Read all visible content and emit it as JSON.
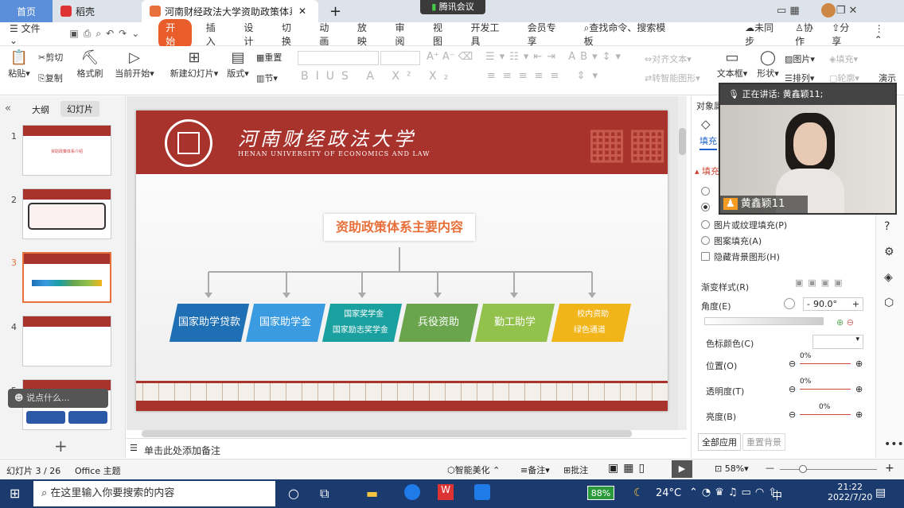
{
  "tabs": {
    "home": "首页",
    "daoke": "稻壳",
    "doc": "河南财经政法大学资助政策体系",
    "meeting": "腾讯会议"
  },
  "menu": {
    "file": "文件",
    "start": "开始",
    "items": [
      "插入",
      "设计",
      "切换",
      "动画",
      "放映",
      "审阅",
      "视图",
      "开发工具",
      "会员专享"
    ],
    "search": "查找命令、搜索模板",
    "sync": "未同步",
    "collab": "协作",
    "share": "分享"
  },
  "ribbon": {
    "paste": "粘贴",
    "cut": "剪切",
    "copy": "复制",
    "format_painter": "格式刷",
    "play_from_current": "当前开始",
    "new_slide": "新建幻灯片",
    "layout": "版式",
    "reset": "重置",
    "section": "节",
    "align_text": "对齐文本",
    "smart_graphic": "转智能图形",
    "textbox": "文本框",
    "shape": "形状",
    "picture": "图片",
    "fill": "填充",
    "arrange": "排列",
    "outline": "轮廓",
    "presenter": "演示"
  },
  "left_panel": {
    "outline_tab": "大纲",
    "slides_tab": "幻灯片",
    "thumb1_title": "资助政策体系介绍",
    "tooltip": "说点什么..."
  },
  "slide": {
    "univ_cn": "河南财经政法大学",
    "univ_en": "HENAN UNIVERSITY OF ECONOMICS AND LAW",
    "title": "资助政策体系主要内容",
    "boxes": [
      {
        "lines": [
          "国家助学贷款"
        ],
        "color": "#1e6fb3"
      },
      {
        "lines": [
          "国家助学金"
        ],
        "color": "#3a9be0"
      },
      {
        "lines": [
          "国家奖学金",
          "国家励志奖学金"
        ],
        "color": "#1ba0a0"
      },
      {
        "lines": [
          "兵役资助"
        ],
        "color": "#6aa54e"
      },
      {
        "lines": [
          "勤工助学"
        ],
        "color": "#92c14c"
      },
      {
        "lines": [
          "校内资助",
          "绿色通道"
        ],
        "color": "#f2b519"
      }
    ]
  },
  "notes_placeholder": "单击此处添加备注",
  "right_panel": {
    "object_props": "对象属",
    "fill_tab": "填充",
    "fill_section": "填充",
    "opt_picture_fill": "图片或纹理填充(P)",
    "opt_pattern_fill": "图案填充(A)",
    "opt_hide_bg": "隐藏背景图形(H)",
    "gradient_style": "渐变样式(R)",
    "angle_label": "角度(E)",
    "angle_value": "90.0°",
    "stop_color": "色标颜色(C)",
    "position": "位置(O)",
    "transparency": "透明度(T)",
    "brightness": "亮度(B)",
    "pct": "0%",
    "apply_all": "全部应用",
    "reset_bg": "重置背景"
  },
  "video": {
    "speaking": "正在讲话: 黄鑫颖11;",
    "name": "黄鑫颖11"
  },
  "status": {
    "slide_count": "幻灯片 3 / 26",
    "theme": "Office 主题",
    "beautify": "智能美化",
    "notes": "备注",
    "comment": "批注",
    "zoom": "58%"
  },
  "taskbar": {
    "search": "在这里输入你要搜索的内容",
    "battery": "88%",
    "weather": "24°C",
    "time": "21:22",
    "date": "2022/7/20",
    "ime": "中"
  }
}
